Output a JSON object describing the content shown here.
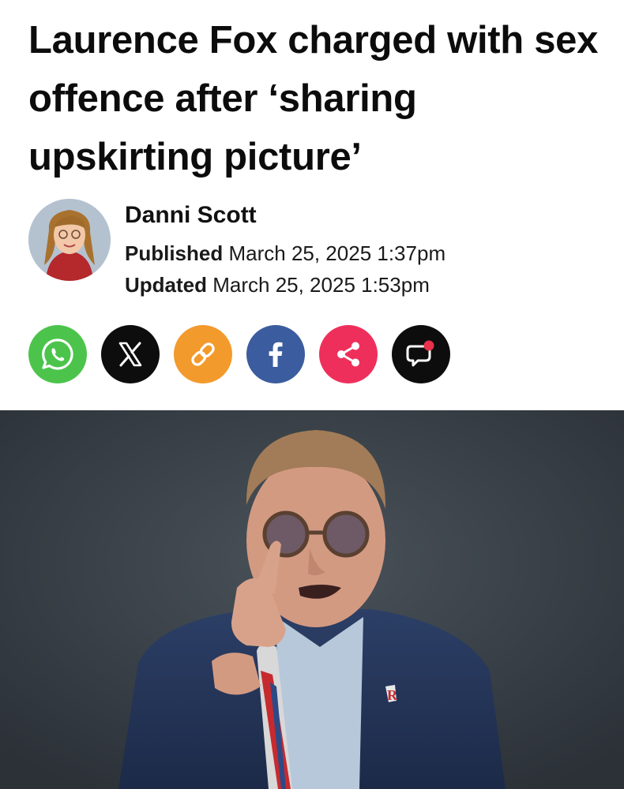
{
  "article": {
    "headline": "Laurence Fox charged with sex offence after ‘sharing upskirting picture’"
  },
  "author": {
    "name": "Danni Scott",
    "published_label": "Published",
    "published_value": "March 25, 2025 1:37pm",
    "updated_label": "Updated",
    "updated_value": "March 25, 2025 1:53pm"
  },
  "share_buttons": [
    {
      "icon": "whatsapp-icon",
      "color": "#4cc44c"
    },
    {
      "icon": "x-icon",
      "color": "#0d0d0d"
    },
    {
      "icon": "link-icon",
      "color": "#f39a2c"
    },
    {
      "icon": "facebook-icon",
      "color": "#3b5c9e"
    },
    {
      "icon": "share-icon",
      "color": "#ef2f5b"
    },
    {
      "icon": "comment-icon",
      "color": "#0d0d0d"
    }
  ]
}
